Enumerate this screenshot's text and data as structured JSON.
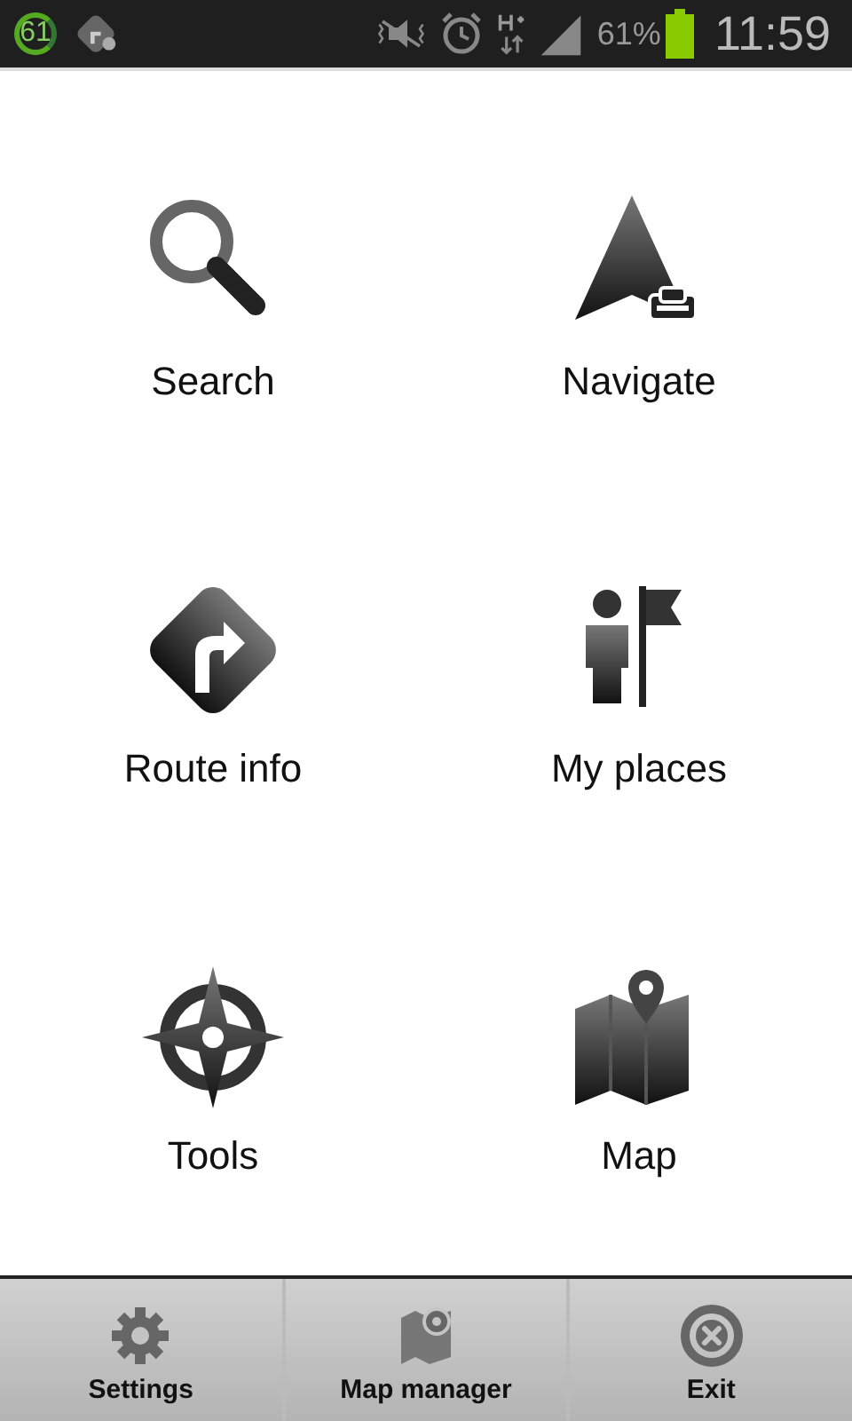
{
  "status_bar": {
    "badge": "61",
    "battery_percent": "61%",
    "time": "11:59"
  },
  "menu": [
    {
      "kind": "search",
      "label": "Search"
    },
    {
      "kind": "navigate",
      "label": "Navigate"
    },
    {
      "kind": "route",
      "label": "Route info"
    },
    {
      "kind": "places",
      "label": "My places"
    },
    {
      "kind": "tools",
      "label": "Tools"
    },
    {
      "kind": "map",
      "label": "Map"
    }
  ],
  "toolbar": [
    {
      "kind": "settings",
      "label": "Settings"
    },
    {
      "kind": "map_manager",
      "label": "Map manager"
    },
    {
      "kind": "exit",
      "label": "Exit"
    }
  ]
}
